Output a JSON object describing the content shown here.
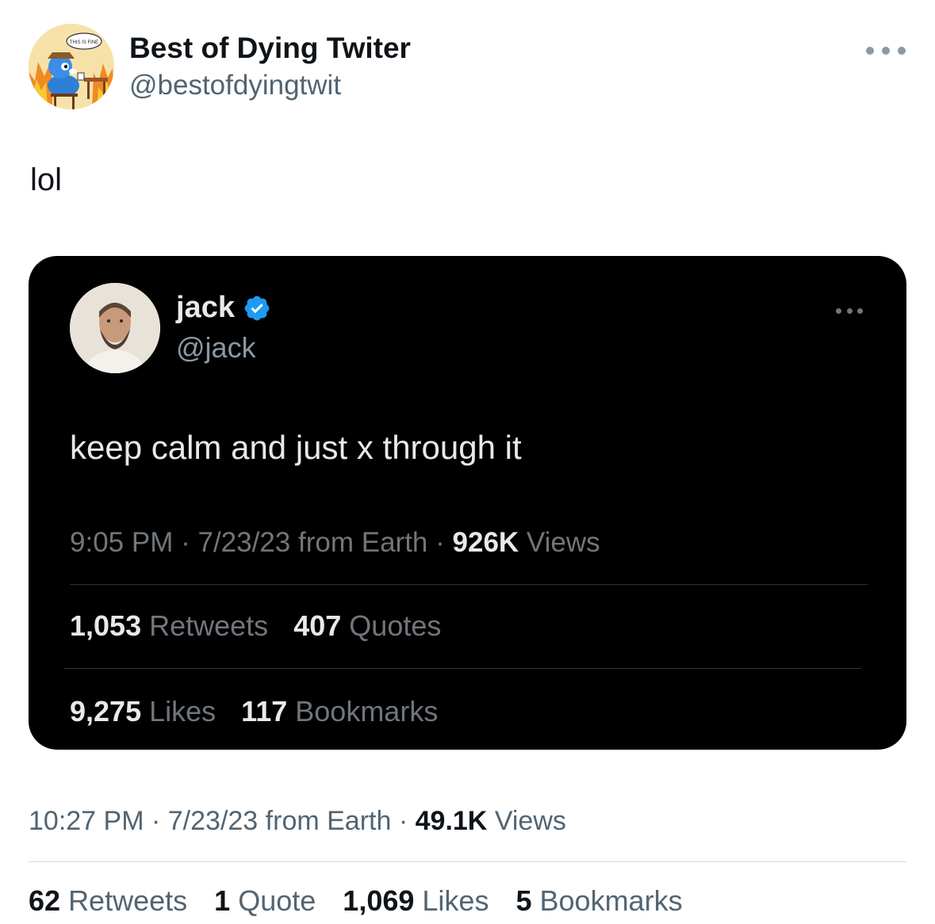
{
  "outer_tweet": {
    "author_name": "Best of Dying Twiter",
    "author_handle": "@bestofdyingtwit",
    "avatar_icon": "this-is-fine-dog-avatar",
    "avatar_sign_text": "THIS IS FINE",
    "text": "lol",
    "time": "10:27 PM",
    "date": "7/23/23",
    "location": "from Earth",
    "views_count": "49.1K",
    "views_label": "Views",
    "stats": [
      {
        "count": "62",
        "label": "Retweets"
      },
      {
        "count": "1",
        "label": "Quote"
      },
      {
        "count": "1,069",
        "label": "Likes"
      },
      {
        "count": "5",
        "label": "Bookmarks"
      }
    ]
  },
  "quoted_tweet": {
    "author_name": "jack",
    "author_handle": "@jack",
    "verified": true,
    "verified_color": "#1d9bf0",
    "text": "keep calm and just x through it",
    "time": "9:05 PM",
    "date": "7/23/23",
    "location": "from Earth",
    "views_count": "926K",
    "views_label": "Views",
    "stats_row1": [
      {
        "count": "1,053",
        "label": "Retweets"
      },
      {
        "count": "407",
        "label": "Quotes"
      }
    ],
    "stats_row2": [
      {
        "count": "9,275",
        "label": "Likes"
      },
      {
        "count": "117",
        "label": "Bookmarks"
      }
    ]
  },
  "separator": "·"
}
